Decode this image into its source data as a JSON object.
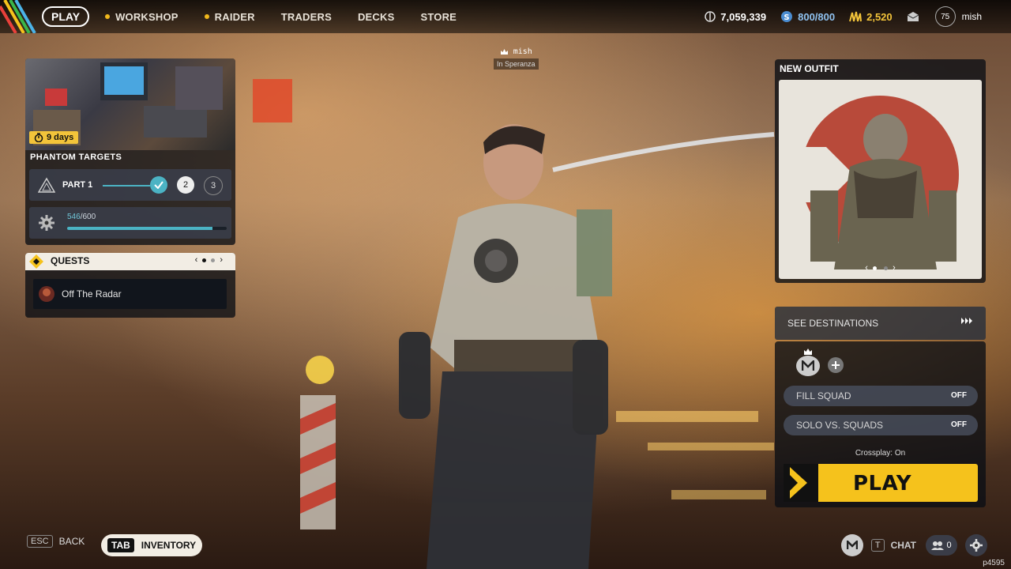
{
  "topbar": {
    "play_label": "PLAY",
    "nav": [
      {
        "label": "WORKSHOP",
        "dot": true
      },
      {
        "label": "RAIDER",
        "dot": true
      },
      {
        "label": "TRADERS",
        "dot": false
      },
      {
        "label": "DECKS",
        "dot": false
      },
      {
        "label": "STORE",
        "dot": false
      }
    ],
    "coins": "7,059,339",
    "cred": "800/800",
    "raider_tokens": "2,520",
    "level": "75",
    "username": "mish"
  },
  "event": {
    "days": "9 days",
    "title": "PHANTOM TARGETS",
    "part_label": "PART 1",
    "steps": [
      "2",
      "3"
    ],
    "progress_current": "546",
    "progress_max": "/600",
    "progress_fraction": 0.91
  },
  "quests": {
    "title": "QUESTS",
    "item": "Off The Radar"
  },
  "player_tag": {
    "name": "mish",
    "location": "In Speranza"
  },
  "outfit": {
    "title": "NEW OUTFIT"
  },
  "destinations": {
    "label": "SEE DESTINATIONS"
  },
  "squad": {
    "fill_squad_label": "FILL SQUAD",
    "fill_squad_value": "OFF",
    "solo_label": "SOLO VS. SQUADS",
    "solo_value": "OFF",
    "crossplay": "Crossplay: On",
    "play_label": "PLAY"
  },
  "bottom": {
    "esc_key": "ESC",
    "back_label": "BACK",
    "tab_key": "TAB",
    "inventory_label": "INVENTORY",
    "t_key": "T",
    "chat_label": "CHAT",
    "friends_count": "0",
    "version": "p4595"
  },
  "colors": {
    "accent_yellow": "#f5c21c",
    "accent_cyan": "#4bb3c4",
    "cred_blue": "#8fc2f0"
  }
}
